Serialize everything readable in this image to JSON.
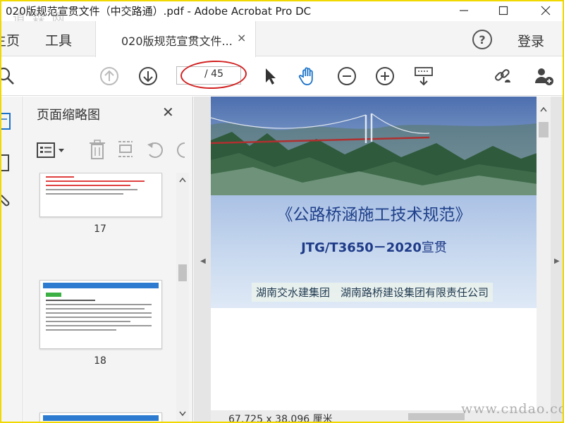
{
  "window": {
    "title": "020版规范宣贯文件（中交路通）.pdf - Adobe Acrobat Pro DC",
    "watermark_top": "道 森 网",
    "minimize_icon": "minimize-icon",
    "maximize_icon": "maximize-icon",
    "close_icon": "close-icon"
  },
  "menubar": {
    "home_label": "主页",
    "tools_label": "工具",
    "doc_tab_label": "020版规范宣贯文件...",
    "doc_tab_close": "×",
    "help_icon": "help-icon",
    "help_glyph": "?",
    "login_label": "登录"
  },
  "toolbar": {
    "icons": [
      "zoom-search-icon",
      "prev-page-icon",
      "next-page-icon",
      "select-cursor-icon",
      "hand-tool-icon",
      "zoom-out-icon",
      "zoom-in-icon",
      "keyboard-icon",
      "link-icon",
      "add-user-icon"
    ],
    "page_current": "",
    "page_total": "/ 45"
  },
  "thumbnails": {
    "title": "页面缩略图",
    "close": "✕",
    "pages": [
      {
        "number": "17"
      },
      {
        "number": "18"
      }
    ]
  },
  "document": {
    "title": "《公路桥涵施工技术规范》",
    "code_bold": "JTG/T3650－2020",
    "code_suffix": "宣贯",
    "publisher": "湖南交水建集团　湖南路桥建设集团有限责任公司",
    "dimensions": "67.725 x 38.096 厘米"
  },
  "watermark_bottom": "www.cndao.com",
  "colors": {
    "accent_blue": "#1e3f8a",
    "annotation_red": "#d22020",
    "hand_tool_blue": "#1a73c9"
  }
}
